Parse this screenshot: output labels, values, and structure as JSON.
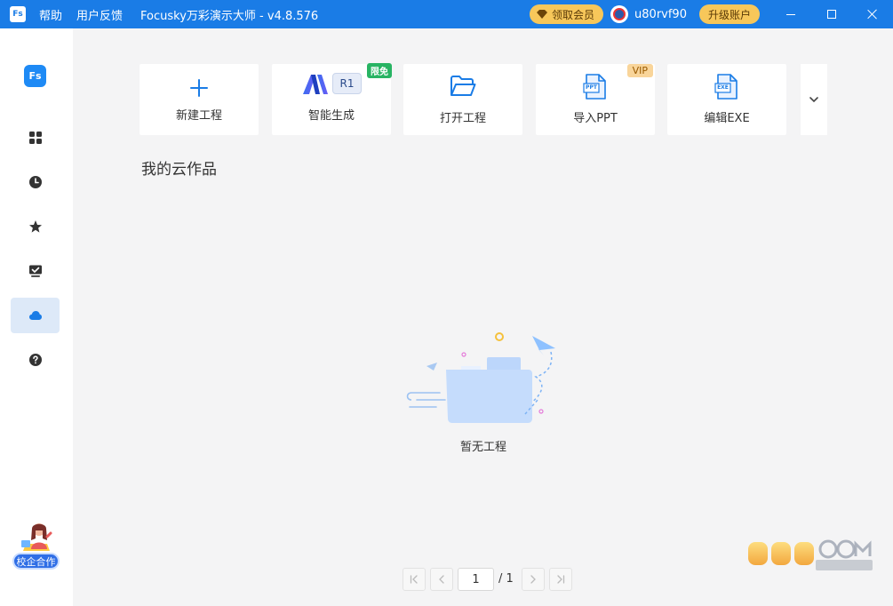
{
  "titlebar": {
    "logo_text": "Fs",
    "menu": [
      "帮助",
      "用户反馈"
    ],
    "app_title": "Focusky万彩演示大师 - v4.8.576",
    "vip_label": "领取会员",
    "username": "u80rvf90",
    "upgrade_label": "升级账户"
  },
  "sidebar": {
    "logo_text": "Fs",
    "items": [
      {
        "icon": "grid-icon"
      },
      {
        "icon": "clock-icon"
      },
      {
        "icon": "star-icon"
      },
      {
        "icon": "monitor-check-icon"
      },
      {
        "icon": "cloud-icon",
        "active": true
      },
      {
        "icon": "help-icon"
      }
    ],
    "coop_label": "校企合作"
  },
  "actions": {
    "new_project": "新建工程",
    "ai_generate": "智能生成",
    "ai_badge_r1": "R1",
    "ai_badge_free": "限免",
    "open_project": "打开工程",
    "import_ppt": "导入PPT",
    "import_ppt_file": "PPT",
    "vip_badge": "VIP",
    "edit_exe": "编辑EXE",
    "edit_exe_file": "EXE"
  },
  "main": {
    "section_title": "我的云作品",
    "empty_text": "暂无工程"
  },
  "pagination": {
    "current": "1",
    "total": "/ 1"
  },
  "colors": {
    "titlebar": "#1a7ce6",
    "accent": "#1e8af5",
    "vip_gold": "#f7c75a",
    "badge_green": "#28b463"
  }
}
